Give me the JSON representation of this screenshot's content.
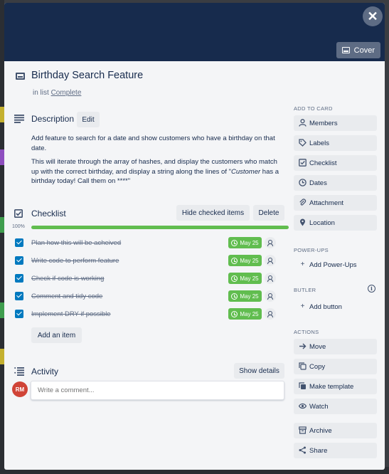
{
  "cover": {
    "button_label": "Cover",
    "close_glyph": "✕"
  },
  "card": {
    "title": "Birthday Search Feature",
    "in_list_prefix": "in list",
    "list_name": "Complete"
  },
  "description": {
    "heading": "Description",
    "edit_label": "Edit",
    "para1": "Add feature to search for a date and show customers who have a birthday on that date.",
    "para2_a": "This will iterate through the array of hashes, and display the customers who match up with the correct birthday, and display a string along the lines of \"",
    "para2_em": "Customer",
    "para2_b": " has a birthday today! Call them on ****\""
  },
  "checklist": {
    "heading": "Checklist",
    "hide_label": "Hide checked items",
    "delete_label": "Delete",
    "progress_text": "100%",
    "progress_value": 100,
    "progress_color": "#61bd4f",
    "items": [
      {
        "text": "Plan how this will be acheived",
        "due": "May 25"
      },
      {
        "text": "Write code to perform feature",
        "due": "May 25"
      },
      {
        "text": "Check if code is working",
        "due": "May 25"
      },
      {
        "text": "Comment and tidy code",
        "due": "May 25"
      },
      {
        "text": "Implement DRY if possible",
        "due": "May 25"
      }
    ],
    "add_item_label": "Add an item"
  },
  "activity": {
    "heading": "Activity",
    "show_details_label": "Show details",
    "avatar_initials": "RM",
    "avatar_color": "#d04437",
    "comment_placeholder": "Write a comment..."
  },
  "sidebar": {
    "add_to_card_label": "ADD TO CARD",
    "add_to_card": [
      {
        "label": "Members",
        "icon": "person-icon"
      },
      {
        "label": "Labels",
        "icon": "tag-icon"
      },
      {
        "label": "Checklist",
        "icon": "checklist-icon"
      },
      {
        "label": "Dates",
        "icon": "clock-icon"
      },
      {
        "label": "Attachment",
        "icon": "paperclip-icon"
      },
      {
        "label": "Location",
        "icon": "pin-icon"
      }
    ],
    "powerups_label": "POWER-UPS",
    "add_powerups_label": "Add Power-Ups",
    "butler_label": "BUTLER",
    "add_button_label": "Add button",
    "actions_label": "ACTIONS",
    "actions": [
      {
        "label": "Move",
        "icon": "arrow-right-icon"
      },
      {
        "label": "Copy",
        "icon": "copy-icon"
      },
      {
        "label": "Make template",
        "icon": "template-icon"
      },
      {
        "label": "Watch",
        "icon": "eye-icon"
      },
      {
        "label": "Archive",
        "icon": "archive-icon"
      },
      {
        "label": "Share",
        "icon": "share-icon"
      }
    ]
  },
  "colors": {
    "cover_bg": "#172b4d",
    "check_blue": "#0079bf",
    "due_green": "#61bd4f"
  }
}
